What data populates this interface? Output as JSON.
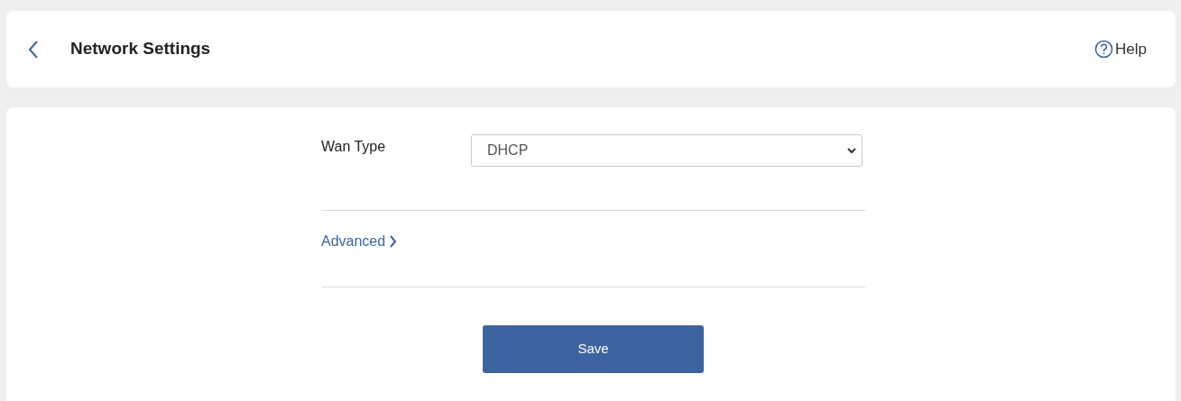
{
  "header": {
    "title": "Network Settings",
    "help": "Help"
  },
  "form": {
    "wan_type": {
      "label": "Wan Type",
      "value": "DHCP"
    },
    "advanced": {
      "label": "Advanced",
      "expanded": false
    },
    "save_button": "Save"
  }
}
